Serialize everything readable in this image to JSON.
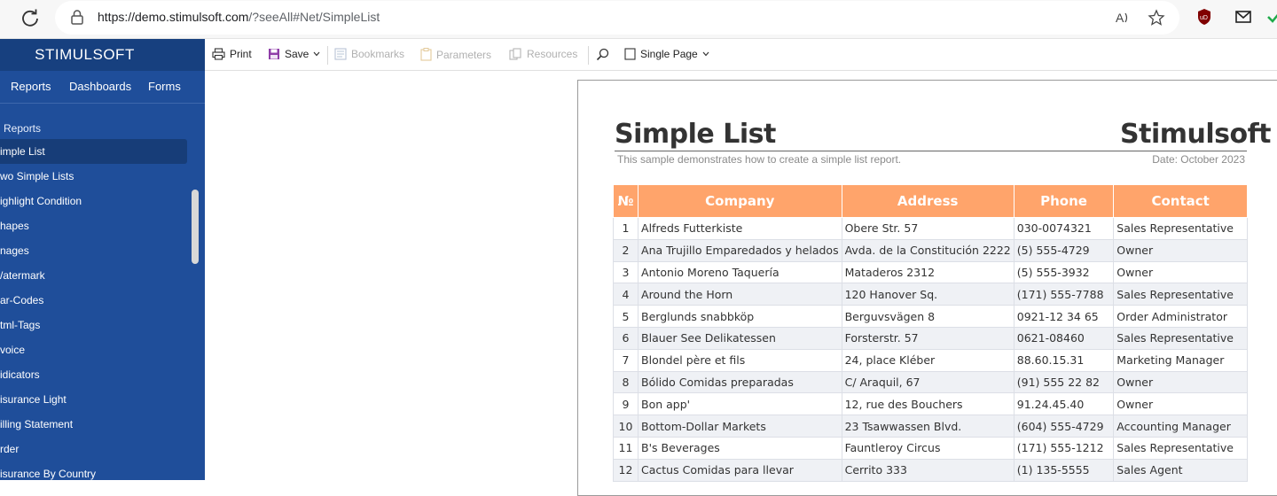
{
  "browser": {
    "url_host": "https://demo.stimulsoft.com",
    "url_path": "/?seeAll#Net/SimpleList"
  },
  "sidebar": {
    "brand": "STIMULSOFT",
    "nav": [
      "Reports",
      "Dashboards",
      "Forms"
    ],
    "group": "Reports",
    "items": [
      {
        "label": "imple List",
        "active": true
      },
      {
        "label": "wo Simple Lists"
      },
      {
        "label": "ighlight Condition"
      },
      {
        "label": "hapes"
      },
      {
        "label": "nages"
      },
      {
        "label": "/atermark"
      },
      {
        "label": "ar-Codes"
      },
      {
        "label": "tml-Tags"
      },
      {
        "label": "voice"
      },
      {
        "label": "idicators"
      },
      {
        "label": "isurance Light"
      },
      {
        "label": "illing Statement"
      },
      {
        "label": "rder"
      },
      {
        "label": "isurance By Country"
      }
    ]
  },
  "toolbar": {
    "print": "Print",
    "save": "Save",
    "bookmarks": "Bookmarks",
    "parameters": "Parameters",
    "resources": "Resources",
    "view_mode": "Single Page"
  },
  "report": {
    "title": "Simple List",
    "brand": "Stimulsoft",
    "subtitle": "This sample demonstrates how to create a simple list report.",
    "date": "Date: October 2023",
    "columns": [
      "№",
      "Company",
      "Address",
      "Phone",
      "Contact"
    ],
    "rows": [
      [
        "1",
        "Alfreds Futterkiste",
        "Obere Str. 57",
        "030-0074321",
        "Sales Representative"
      ],
      [
        "2",
        "Ana Trujillo Emparedados y helados",
        "Avda. de la Constitución 2222",
        "(5) 555-4729",
        "Owner"
      ],
      [
        "3",
        "Antonio Moreno Taquería",
        "Mataderos 2312",
        "(5) 555-3932",
        "Owner"
      ],
      [
        "4",
        "Around the Horn",
        "120 Hanover Sq.",
        "(171) 555-7788",
        "Sales Representative"
      ],
      [
        "5",
        "Berglunds snabbköp",
        "Berguvsvägen 8",
        "0921-12 34 65",
        "Order Administrator"
      ],
      [
        "6",
        "Blauer See Delikatessen",
        "Forsterstr. 57",
        "0621-08460",
        "Sales Representative"
      ],
      [
        "7",
        "Blondel père et fils",
        "24, place Kléber",
        "88.60.15.31",
        "Marketing Manager"
      ],
      [
        "8",
        "Bólido Comidas preparadas",
        "C/ Araquil, 67",
        "(91) 555 22 82",
        "Owner"
      ],
      [
        "9",
        "Bon app'",
        "12, rue des Bouchers",
        "91.24.45.40",
        "Owner"
      ],
      [
        "10",
        "Bottom-Dollar Markets",
        "23 Tsawwassen Blvd.",
        "(604) 555-4729",
        "Accounting Manager"
      ],
      [
        "11",
        "B's Beverages",
        "Fauntleroy Circus",
        "(171) 555-1212",
        "Sales Representative"
      ],
      [
        "12",
        "Cactus Comidas para llevar",
        "Cerrito 333",
        "(1) 135-5555",
        "Sales Agent"
      ]
    ]
  },
  "colors": {
    "sidebar_bg": "#1f4e9a",
    "header_orange": "#ffa46b"
  }
}
